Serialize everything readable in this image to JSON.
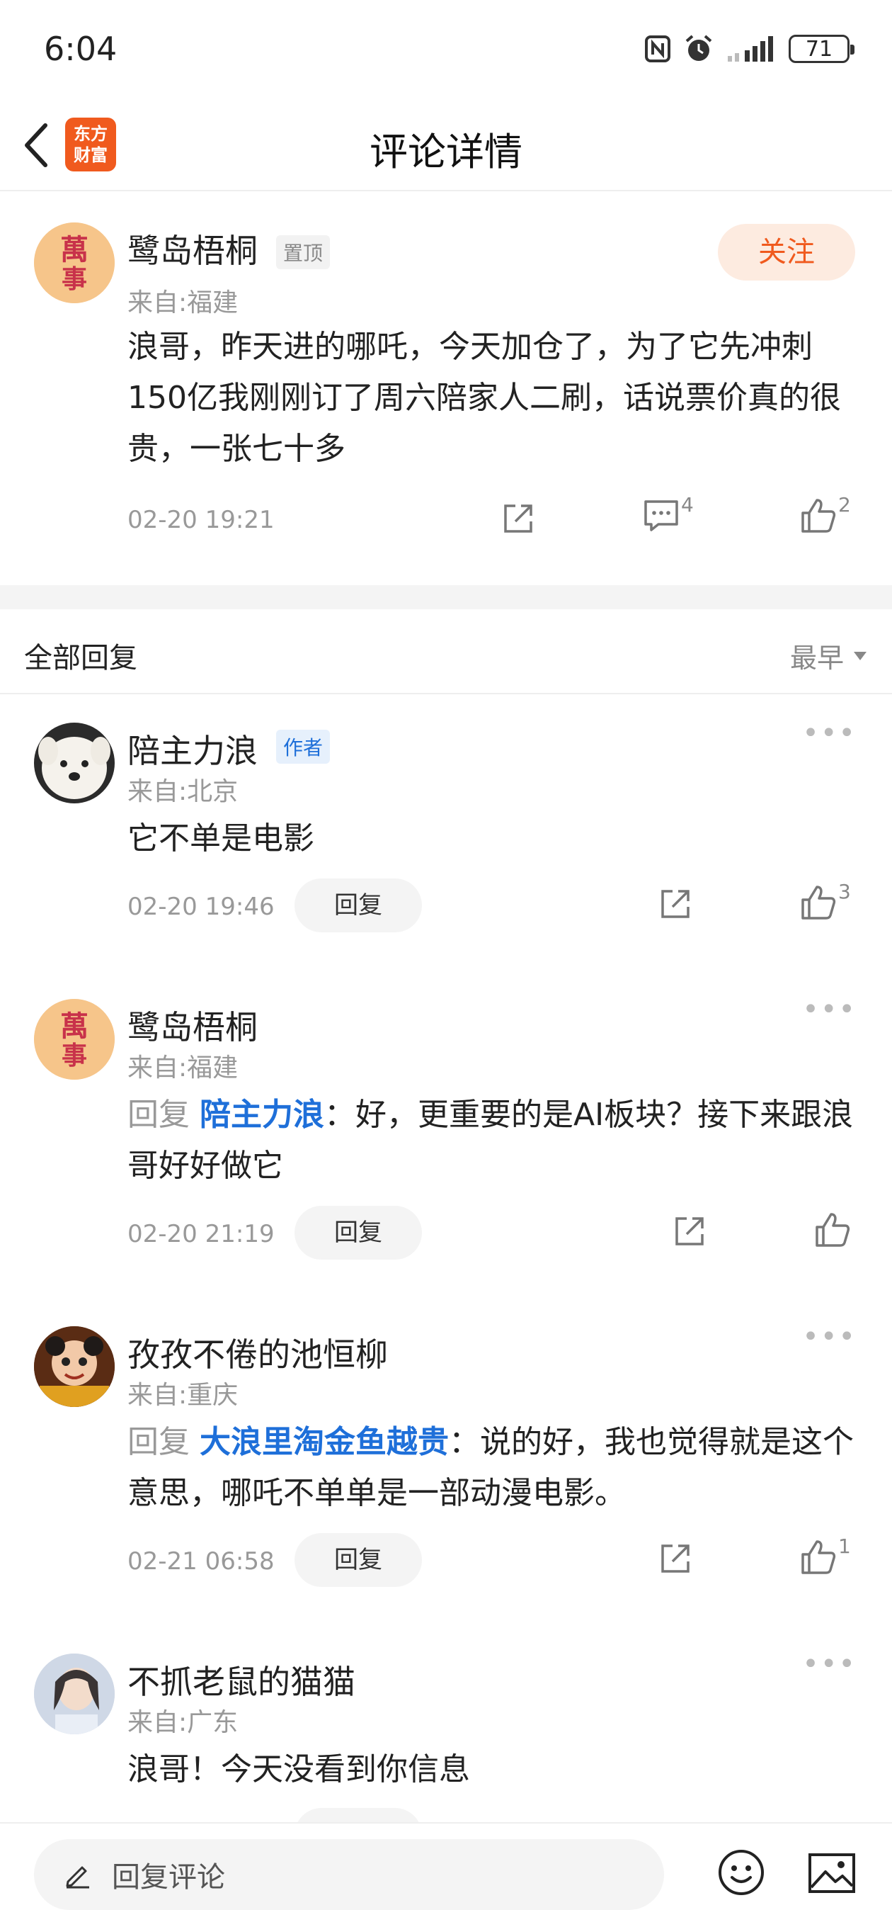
{
  "status_bar": {
    "time": "6:04",
    "battery": "71"
  },
  "nav": {
    "title": "评论详情",
    "logo_line1": "东方",
    "logo_line2": "财富"
  },
  "main_comment": {
    "username": "鹭岛梧桐",
    "pin_tag": "置顶",
    "from": "来自:福建",
    "follow_label": "关注",
    "text": "浪哥，昨天进的哪吒，今天加仓了，为了它先冲刺150亿我刚刚订了周六陪家人二刷，话说票价真的很贵，一张七十多",
    "time": "02-20 19:21",
    "comment_count": "4",
    "like_count": "2"
  },
  "replies_header": {
    "title": "全部回复",
    "sort_label": "最早"
  },
  "replies": [
    {
      "username": "陪主力浪",
      "author_tag": "作者",
      "from": "来自:北京",
      "text": "它不单是电影",
      "time": "02-20 19:46",
      "reply_label": "回复",
      "like_count": "3"
    },
    {
      "username": "鹭岛梧桐",
      "from": "来自:福建",
      "reply_prefix": "回复",
      "mention": "陪主力浪",
      "text": "：好，更重要的是AI板块？接下来跟浪哥好好做它",
      "time": "02-20 21:19",
      "reply_label": "回复",
      "like_count": ""
    },
    {
      "username": "孜孜不倦的池恒柳",
      "from": "来自:重庆",
      "reply_prefix": "回复",
      "mention": "大浪里淘金鱼越贵",
      "text": "：说的好，我也觉得就是这个意思，哪吒不单单是一部动漫电影。",
      "time": "02-21 06:58",
      "reply_label": "回复",
      "like_count": "1"
    },
    {
      "username": "不抓老鼠的猫猫",
      "from": "来自:广东",
      "text": "浪哥！今天没看到你信息"
    }
  ],
  "bottom_bar": {
    "placeholder": "回复评论"
  },
  "colors": {
    "accent": "#f05a1e",
    "link": "#1e6fd9",
    "muted": "#999999"
  }
}
